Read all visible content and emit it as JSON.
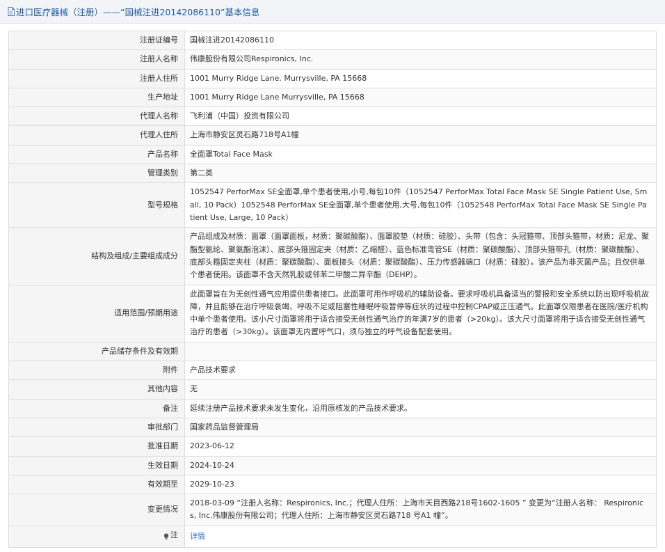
{
  "header": {
    "title": "进口医疗器械（注册）——“国械注进20142086110”基本信息",
    "icon": "document-icon"
  },
  "colors": {
    "link": "#2a6fc7",
    "title": "#1f5aa0",
    "label_bg": "#f5f5f5",
    "border": "#dcdcdc"
  },
  "rows": [
    {
      "label": "注册证编号",
      "value": "国械注进20142086110"
    },
    {
      "label": "注册人名称",
      "value": "伟康股份有限公司Respironics, Inc."
    },
    {
      "label": "注册人住所",
      "value": "1001 Murry Ridge Lane. Murrysville, PA 15668"
    },
    {
      "label": "生产地址",
      "value": "1001 Murry Ridge Lane Murrysville, PA 15668"
    },
    {
      "label": "代理人名称",
      "value": "飞利浦（中国）投资有限公司"
    },
    {
      "label": "代理人住所",
      "value": "上海市静安区灵石路718号A1幢"
    },
    {
      "label": "产品名称",
      "value": "全面罩Total Face Mask"
    },
    {
      "label": "管理类别",
      "value": "第二类"
    },
    {
      "label": "型号规格",
      "value": "1052547 PerforMax SE全面罩,单个患者使用,小号,每包10件（1052547 PerforMax Total Face Mask SE Single Patient Use, Small, 10 Pack）1052548 PerforMax SE全面罩,单个患者使用,大号,每包10件（1052548 PerforMax Total Face Mask SE Single Patient Use, Large, 10 Pack）"
    },
    {
      "label": "结构及组成/主要组成成分",
      "value": "产品组成及材质：面罩（面罩面板，材质：聚碳酸酯）、面罩胶垫（材质：硅胶）、头带（包含：头冠箍带、顶部头箍带，材质：尼龙、聚酯型氨纶、聚氨酯泡沫）、底部头箍固定夹（材质：乙缩醛）、蓝色标准弯管SE（材质：聚碳酸酯）、顶部头箍带孔（材质：聚碳酸酯）、底部头箍固定夹柱（材质：聚碳酸酯）、面板接头（材质：聚碳酸酯）、压力传感器端口（材质：硅胶）。该产品为非灭菌产品；且仅供单个患者使用。该面罩不含天然乳胶或邻苯二甲酸二异辛酯（DEHP）。"
    },
    {
      "label": "适用范围/预期用途",
      "value": "此面罩旨在为无创性通气应用提供患者接口。此面罩可用作呼吸机的辅助设备。要求呼吸机具备适当的警报和安全系统以防出现呼吸机故障，并且能够在治疗呼吸衰竭、呼吸不足或阻塞性睡眠呼吸暂停等症状的过程中控制CPAP或正压通气。此面罩仅限患者在医院/医疗机构中单个患者使用。该小尺寸面罩将用于适合接受无创性通气治疗的年满7岁的患者（>20kg）。该大尺寸面罩将用于适合接受无创性通气治疗的患者（>30kg）。该面罩无内置呼气口，须与独立的呼气设备配套使用。"
    },
    {
      "label": "产品储存条件及有效期",
      "value": ""
    },
    {
      "label": "附件",
      "value": "产品技术要求"
    },
    {
      "label": "其他内容",
      "value": "无"
    },
    {
      "label": "备注",
      "value": "延续注册产品技术要求未发生变化，沿用原核发的产品技术要求。"
    },
    {
      "label": "审批部门",
      "value": "国家药品监督管理局"
    },
    {
      "label": "批准日期",
      "value": "2023-06-12"
    },
    {
      "label": "生效日期",
      "value": "2024-10-24"
    },
    {
      "label": "有效期至",
      "value": "2029-10-23"
    },
    {
      "label": "变更情况",
      "value": "2018-03-09 “注册人名称：Respironics, Inc.；代理人住所：上海市天目西路218号1602-1605 ” 变更为“注册人名称： Respironics, Inc.伟康股份有限公司；代理人住所：上海市静安区灵石路718 号A1 幢”。"
    }
  ],
  "note": {
    "label": "注",
    "link_text": "详情",
    "icon": "lightbulb-icon"
  }
}
